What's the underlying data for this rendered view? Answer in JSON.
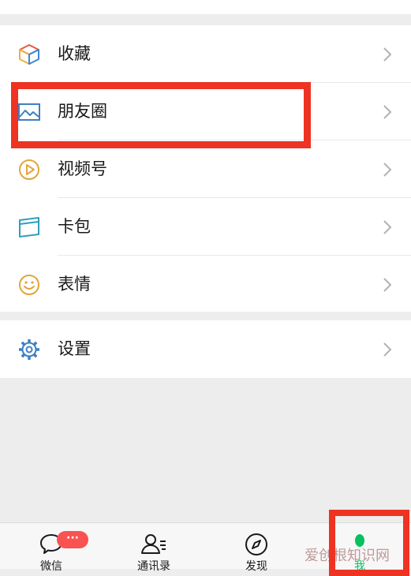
{
  "menu": {
    "favorites": {
      "label": "收藏",
      "icon": "cube-icon"
    },
    "moments": {
      "label": "朋友圈",
      "icon": "image-icon"
    },
    "channels": {
      "label": "视频号",
      "icon": "play-circle-icon"
    },
    "cards": {
      "label": "卡包",
      "icon": "card-icon"
    },
    "stickers": {
      "label": "表情",
      "icon": "smiley-icon"
    },
    "settings": {
      "label": "设置",
      "icon": "gear-icon"
    }
  },
  "tabs": [
    {
      "label": "微信",
      "icon": "chat-bubble-icon",
      "badge": "···"
    },
    {
      "label": "通讯录",
      "icon": "contacts-icon"
    },
    {
      "label": "发现",
      "icon": "compass-icon"
    },
    {
      "label": "我",
      "icon": "person-icon",
      "active": true
    }
  ],
  "colors": {
    "highlight": "#ee3322",
    "accent": "#07c160",
    "badge": "#fa5151"
  },
  "watermark": "爱创根知识网"
}
